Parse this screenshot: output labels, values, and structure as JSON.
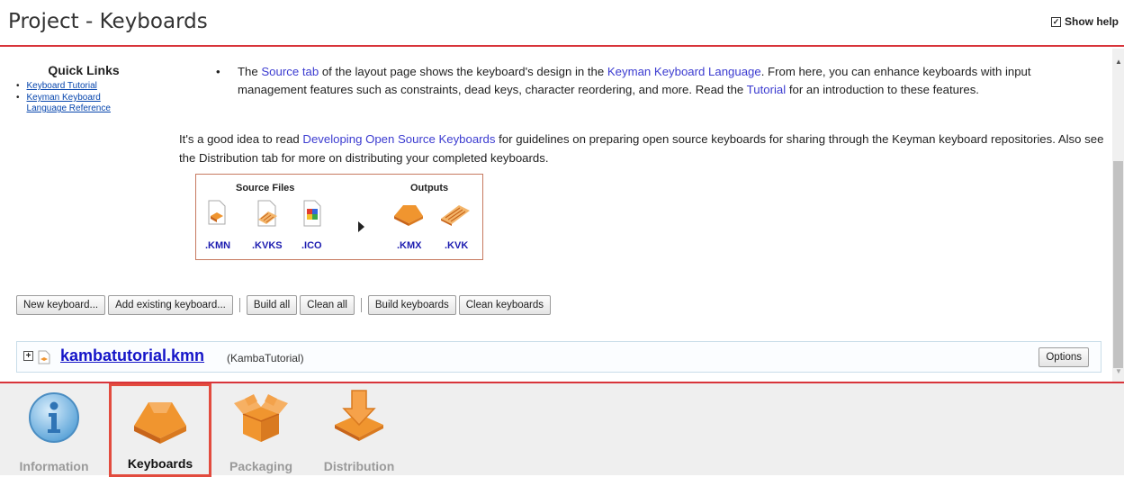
{
  "header": {
    "title": "Project - Keyboards",
    "show_help_label": "Show help",
    "show_help_checked": true
  },
  "quick_links": {
    "title": "Quick Links",
    "items": [
      {
        "label": "Keyboard Tutorial"
      },
      {
        "label": "Keyman Keyboard Language Reference"
      }
    ]
  },
  "help": {
    "bullet": {
      "part1": "The ",
      "link_source_tab": "Source tab",
      "part2": " of the layout page shows the keyboard's design in the ",
      "link_kmn_language": "Keyman Keyboard Language",
      "part3": ". From here, you can enhance keyboards with input management features such as constraints, dead keys, character reordering, and more. Read the ",
      "link_tutorial": "Tutorial",
      "part4": " for an introduction to these features."
    },
    "para2": {
      "part1": "It's a good idea to read ",
      "link_open_source": "Developing Open Source Keyboards",
      "part2": " for guidelines on preparing open source keyboards for sharing through the Keyman keyboard repositories. Also see the Distribution tab for more on distributing your completed keyboards."
    }
  },
  "diagram": {
    "source_files_label": "Source Files",
    "outputs_label": "Outputs",
    "source_files": [
      ".KMN",
      ".KVKS",
      ".ICO"
    ],
    "outputs": [
      ".KMX",
      ".KVK"
    ]
  },
  "toolbar": {
    "new_keyboard": "New keyboard...",
    "add_existing": "Add existing keyboard...",
    "build_all": "Build all",
    "clean_all": "Clean all",
    "build_keyboards": "Build keyboards",
    "clean_keyboards": "Clean keyboards"
  },
  "keyboard": {
    "file_name": "kambatutorial.kmn",
    "id": "(KambaTutorial)",
    "options_label": "Options"
  },
  "tabs": [
    {
      "label": "Information",
      "active": false
    },
    {
      "label": "Keyboards",
      "active": true
    },
    {
      "label": "Packaging",
      "active": false
    },
    {
      "label": "Distribution",
      "active": false
    }
  ],
  "colors": {
    "accent_red": "#d8343a",
    "orange": "#f0952f",
    "link_blue": "#3b3bd0"
  }
}
